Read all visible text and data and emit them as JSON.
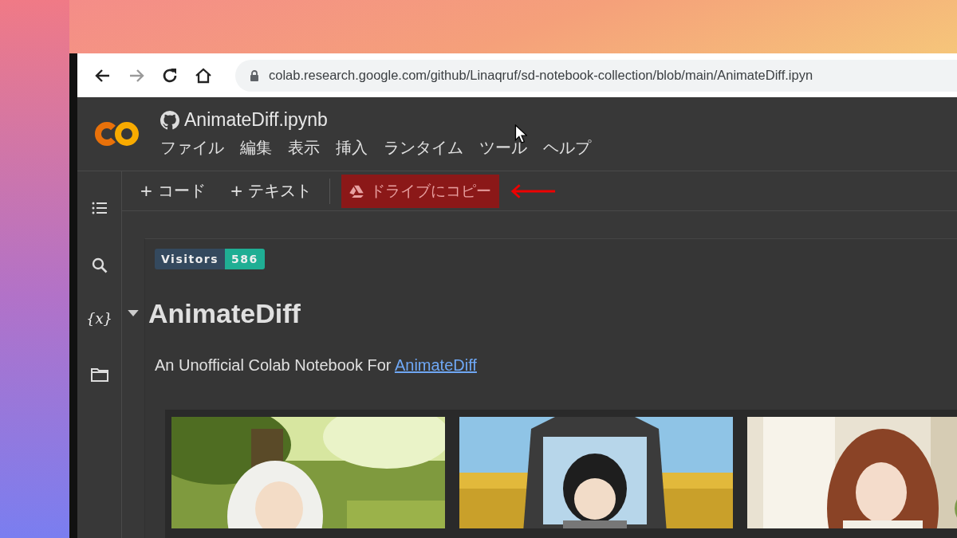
{
  "browser": {
    "url": "colab.research.google.com/github/Linaqruf/sd-notebook-collection/blob/main/AnimateDiff.ipyn"
  },
  "notebook": {
    "title": "AnimateDiff.ipynb",
    "menu": [
      "ファイル",
      "編集",
      "表示",
      "挿入",
      "ランタイム",
      "ツール",
      "ヘルプ"
    ]
  },
  "toolbar": {
    "buttons": [
      {
        "label": "+ コード",
        "kind": "plain",
        "highlighted": false
      },
      {
        "label": "+ テキスト",
        "kind": "plain",
        "highlighted": false
      },
      {
        "label": "ドライブにコピー",
        "kind": "drive",
        "highlighted": true
      }
    ]
  },
  "sidebar": {
    "items": [
      {
        "kind": "toc"
      },
      {
        "kind": "search"
      },
      {
        "kind": "variables",
        "label": "{x}"
      },
      {
        "kind": "files"
      }
    ]
  },
  "cell": {
    "badge": {
      "label": "Visitors",
      "count": "586"
    },
    "heading": "AnimateDiff",
    "expanded": true,
    "text": "An Unofficial Colab Notebook For ",
    "link": "AnimateDiff"
  }
}
